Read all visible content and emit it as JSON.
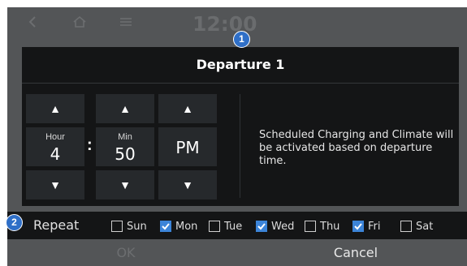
{
  "topbar": {
    "icons": [
      "back-icon",
      "home-icon",
      "menu-icon"
    ],
    "clock": "12:00"
  },
  "dialog": {
    "title": "Departure 1",
    "hour": {
      "label": "Hour",
      "value": "4"
    },
    "minute": {
      "label": "Min",
      "value": "50"
    },
    "ampm": {
      "value": "PM"
    },
    "separator": ":",
    "message": "Scheduled Charging and Climate will be activated based on departure time."
  },
  "callouts": [
    "1",
    "2"
  ],
  "repeat": {
    "label": "Repeat",
    "days": [
      {
        "label": "Sun",
        "checked": false
      },
      {
        "label": "Mon",
        "checked": true
      },
      {
        "label": "Tue",
        "checked": false
      },
      {
        "label": "Wed",
        "checked": true
      },
      {
        "label": "Thu",
        "checked": false
      },
      {
        "label": "Fri",
        "checked": true
      },
      {
        "label": "Sat",
        "checked": false
      }
    ]
  },
  "buttons": {
    "ok": "OK",
    "cancel": "Cancel"
  },
  "colors": {
    "accent": "#3c84d8",
    "badge": "#2f6fc7",
    "panel": "#141516",
    "backdrop": "#535557"
  }
}
